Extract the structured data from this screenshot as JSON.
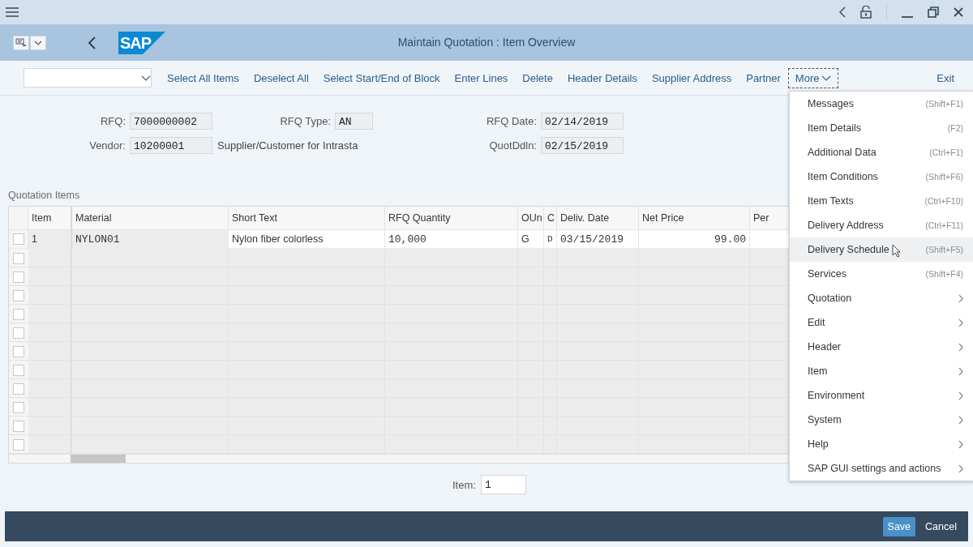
{
  "window": {
    "title": "Maintain Quotation : Item Overview",
    "logo": "SAP"
  },
  "toolbar": {
    "buttons": [
      "Select All Items",
      "Deselect All",
      "Select Start/End of Block",
      "Enter Lines",
      "Delete",
      "Header Details",
      "Supplier Address",
      "Partner"
    ],
    "more": {
      "label": "More",
      "expanded": true
    },
    "exit": "Exit"
  },
  "header_fields": [
    {
      "label": "RFQ:",
      "value": "7000000002",
      "readonly": true
    },
    {
      "label": "RFQ Type:",
      "value": "AN",
      "readonly": true
    },
    {
      "label": "RFQ Date:",
      "value": "02/14/2019",
      "readonly": true
    },
    {
      "label": "Vendor:",
      "value": "10200001",
      "readonly": true,
      "description": "Supplier/Customer for Intrasta"
    },
    {
      "label": "QuotDdln:",
      "value": "02/15/2019",
      "readonly": true
    }
  ],
  "table": {
    "title": "Quotation Items",
    "columns": [
      "Item",
      "Material",
      "Short Text",
      "RFQ Quantity",
      "OUn",
      "C",
      "Deliv. Date",
      "Net Price",
      "Per"
    ],
    "rows": [
      {
        "selected": false,
        "cells": [
          "1",
          "NYLON01",
          "Nylon fiber colorless",
          "10,000",
          "G",
          "D",
          "03/15/2019",
          "99.00",
          ""
        ]
      },
      {
        "selected": false
      },
      {
        "selected": false
      },
      {
        "selected": false
      },
      {
        "selected": false
      },
      {
        "selected": false
      },
      {
        "selected": false
      },
      {
        "selected": false
      },
      {
        "selected": false
      },
      {
        "selected": false
      },
      {
        "selected": false
      },
      {
        "selected": false
      }
    ]
  },
  "item_field": {
    "label": "Item:",
    "value": "1"
  },
  "menu": [
    {
      "kind": "command",
      "label": "Messages",
      "shortcut": "(Shift+F1)",
      "selected": false
    },
    {
      "kind": "command",
      "label": "Item Details",
      "shortcut": "(F2)",
      "selected": false
    },
    {
      "kind": "command",
      "label": "Additional Data",
      "shortcut": "(Ctrl+F1)",
      "selected": false
    },
    {
      "kind": "command",
      "label": "Item Conditions",
      "shortcut": "(Shift+F6)",
      "selected": false
    },
    {
      "kind": "command",
      "label": "Item Texts",
      "shortcut": "(Ctrl+F10)",
      "selected": false
    },
    {
      "kind": "command",
      "label": "Delivery Address",
      "shortcut": "(Ctrl+F11)",
      "selected": false
    },
    {
      "kind": "command",
      "label": "Delivery Schedule",
      "shortcut": "(Shift+F5)",
      "selected": true
    },
    {
      "kind": "command",
      "label": "Services",
      "shortcut": "(Shift+F4)",
      "selected": false
    },
    {
      "kind": "submenu",
      "label": "Quotation",
      "selected": false
    },
    {
      "kind": "submenu",
      "label": "Edit",
      "selected": false
    },
    {
      "kind": "submenu",
      "label": "Header",
      "selected": false
    },
    {
      "kind": "submenu",
      "label": "Item",
      "selected": false
    },
    {
      "kind": "submenu",
      "label": "Environment",
      "selected": false
    },
    {
      "kind": "submenu",
      "label": "System",
      "selected": false
    },
    {
      "kind": "submenu",
      "label": "Help",
      "selected": false
    },
    {
      "kind": "submenu",
      "label": "SAP GUI settings and actions",
      "selected": false
    }
  ],
  "footer": {
    "buttons": [
      {
        "label": "Save",
        "kind": "primary"
      },
      {
        "label": "Cancel",
        "kind": "plain"
      }
    ]
  }
}
